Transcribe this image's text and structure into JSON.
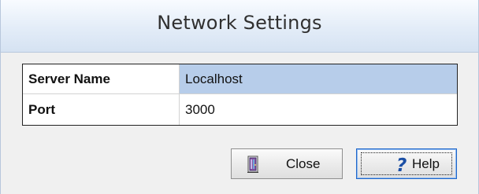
{
  "window": {
    "title": "Network Settings"
  },
  "settings_table": {
    "rows": [
      {
        "label": "Server Name",
        "value": "Localhost",
        "selected": true
      },
      {
        "label": "Port",
        "value": "3000",
        "selected": false
      }
    ]
  },
  "buttons": {
    "close_label": "Close",
    "help_label": "Help",
    "close_icon": "exit-door-icon",
    "help_icon": "question-mark-icon"
  },
  "colors": {
    "selection": "#b7cdea",
    "title_gradient_start": "#f8fbff",
    "title_gradient_end": "#d5e2f2",
    "help_icon": "#1b4fa5",
    "close_icon": "#8a58a8"
  }
}
